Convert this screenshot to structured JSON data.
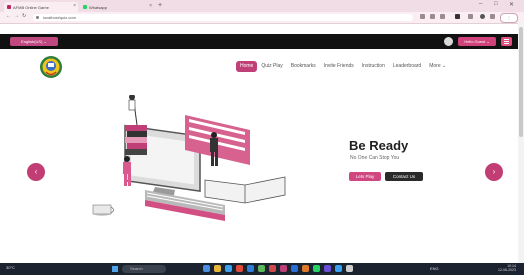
{
  "browser": {
    "tabs": [
      {
        "label": "AFMB Online Game"
      },
      {
        "label": "Whatsapp"
      }
    ],
    "new_tab_icon": "plus-icon",
    "address": "localhost/quiz.com",
    "window_controls": [
      "–",
      "□",
      "✕"
    ]
  },
  "topbar": {
    "language_button": "English(US) ⌄",
    "user_button": "Hello Guest ⌄"
  },
  "nav": {
    "items": [
      "Home",
      "Quiz Play",
      "Bookmarks",
      "Invite Friends",
      "Instruction",
      "Leaderboard",
      "More ⌄"
    ],
    "active": 0
  },
  "hero": {
    "title": "Be Ready",
    "subtitle": "No One Can Stop You",
    "primary_button": "Lets Play",
    "secondary_button": "Contact Us",
    "prev_icon": "chevron-left-icon",
    "next_icon": "chevron-right-icon"
  },
  "taskbar": {
    "weather": "30°C",
    "search_placeholder": "Search",
    "tray": "ENG",
    "time": "10:14",
    "date": "12-06-2023"
  },
  "colors": {
    "accent": "#c03f76",
    "topbar": "#111111",
    "taskbar": "#1b2230",
    "browser_chrome": "#fbeef3"
  }
}
